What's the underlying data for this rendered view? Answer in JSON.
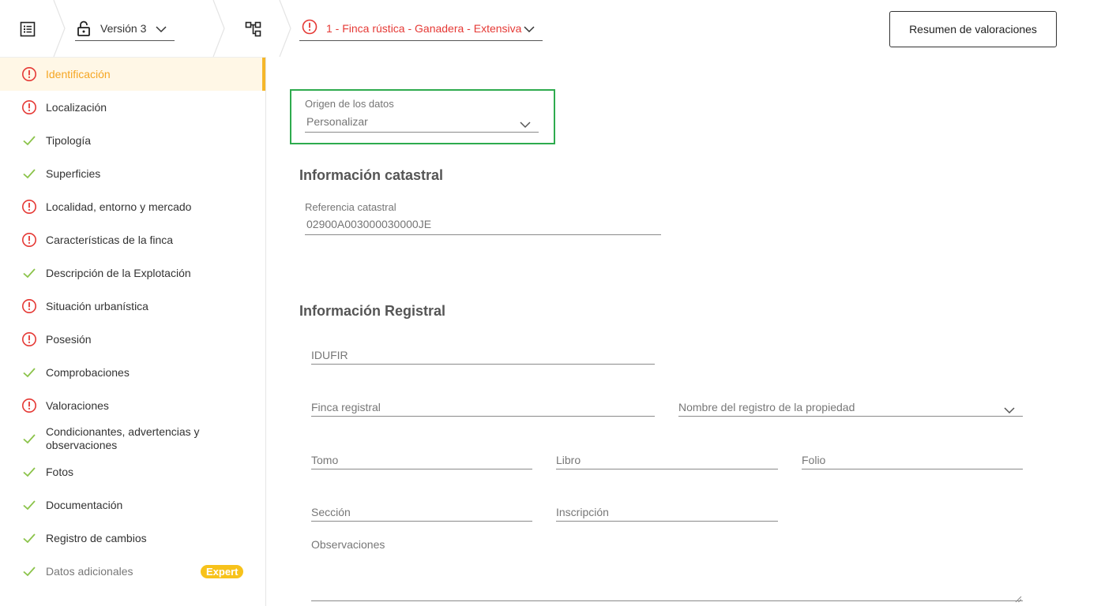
{
  "header": {
    "version_label": "Versión 3",
    "asset_label": "1 - Finca rústica - Ganadera - Extensiva",
    "summary_button": "Resumen de valoraciones"
  },
  "colors": {
    "accent": "#f5a623",
    "error": "#e53935",
    "ok": "#8bc34a",
    "highlight": "#2eab4e",
    "badge": "#f7c21b"
  },
  "sidebar": {
    "items": [
      {
        "label": "Identificación",
        "status": "error",
        "active": true
      },
      {
        "label": "Localización",
        "status": "error"
      },
      {
        "label": "Tipología",
        "status": "ok"
      },
      {
        "label": "Superficies",
        "status": "ok"
      },
      {
        "label": "Localidad, entorno y mercado",
        "status": "error"
      },
      {
        "label": "Características de la finca",
        "status": "error"
      },
      {
        "label": "Descripción de la Explotación",
        "status": "ok"
      },
      {
        "label": "Situación urbanística",
        "status": "error"
      },
      {
        "label": "Posesión",
        "status": "error"
      },
      {
        "label": "Comprobaciones",
        "status": "ok"
      },
      {
        "label": "Valoraciones",
        "status": "error"
      },
      {
        "label": "Condicionantes, advertencias y observaciones",
        "status": "ok"
      },
      {
        "label": "Fotos",
        "status": "ok"
      },
      {
        "label": "Documentación",
        "status": "ok"
      },
      {
        "label": "Registro de cambios",
        "status": "ok"
      },
      {
        "label": "Datos adicionales",
        "status": "ok",
        "badge": "Expert"
      }
    ]
  },
  "form": {
    "origin": {
      "label": "Origen de los datos",
      "value": "Personalizar"
    },
    "cadastral": {
      "title": "Información catastral",
      "ref_label": "Referencia catastral",
      "ref_value": "02900A003000030000JE"
    },
    "registry": {
      "title": "Información Registral",
      "idufir": "IDUFIR",
      "finca_registral": "Finca registral",
      "nombre_registro": "Nombre del registro de la propiedad",
      "tomo": "Tomo",
      "libro": "Libro",
      "folio": "Folio",
      "seccion": "Sección",
      "inscripcion": "Inscripción",
      "observaciones": "Observaciones"
    }
  }
}
